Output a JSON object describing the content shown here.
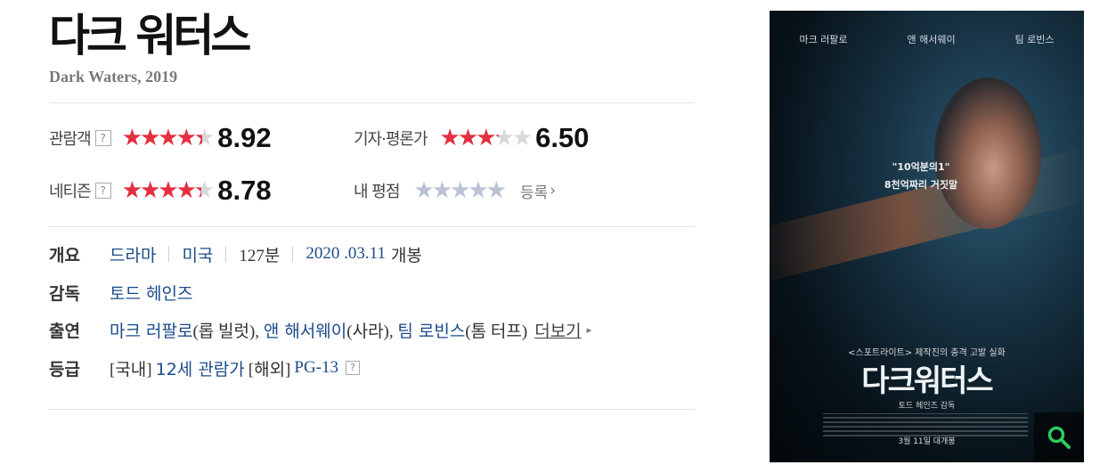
{
  "movie": {
    "title": "다크 워터스",
    "subtitle": "Dark Waters, 2019"
  },
  "ratings": {
    "audience": {
      "label": "관람객",
      "help": "?",
      "score": "8.92",
      "stars_fraction": 0.892
    },
    "critics": {
      "label": "기자·평론가",
      "score": "6.50",
      "stars_fraction": 0.65
    },
    "netizen": {
      "label": "네티즌",
      "help": "?",
      "score": "8.78",
      "stars_fraction": 0.878
    },
    "mine": {
      "label": "내 평점",
      "register": "등록",
      "chevron": "›"
    }
  },
  "stars_glyphs": "★★★★★",
  "info": {
    "overview": {
      "label": "개요",
      "genre": "드라마",
      "country": "미국",
      "runtime": "127분",
      "release_date": "2020 .03.11",
      "release_suffix": "개봉"
    },
    "director": {
      "label": "감독",
      "name": "토드 헤인즈"
    },
    "cast": {
      "label": "출연",
      "members": [
        {
          "name": "마크 러팔로",
          "role": "(롭 빌럿), "
        },
        {
          "name": "앤 해서웨이",
          "role": "(사라), "
        },
        {
          "name": "팀 로빈스",
          "role": "(톰 터프)"
        }
      ],
      "more": "더보기",
      "more_arrow": "▸"
    },
    "grade": {
      "label": "등급",
      "domestic_prefix": "[국내]",
      "domestic": "12세 관람가",
      "overseas_prefix": "[해외]",
      "overseas": "PG-13",
      "help": "?"
    }
  },
  "poster": {
    "actors": [
      "마크 러팔로",
      "앤 해서웨이",
      "팀 로빈스"
    ],
    "quote_line1": "\"10억분의1\"",
    "quote_line2": "8천억짜리 거짓말",
    "tagline": "<스포트라이트> 제작진의 충격 고발 실화",
    "title": "다크워터스",
    "director_credit": "토드 헤인즈 감독",
    "release": "3월 11일 대개봉",
    "zoom_icon": "search-icon"
  },
  "colors": {
    "star_red": "#e42f3f",
    "star_empty": "#d8d8d8",
    "star_mine": "#b9c3d3",
    "link_blue": "#1b4b8a",
    "zoom_green": "#2ecc5a"
  }
}
